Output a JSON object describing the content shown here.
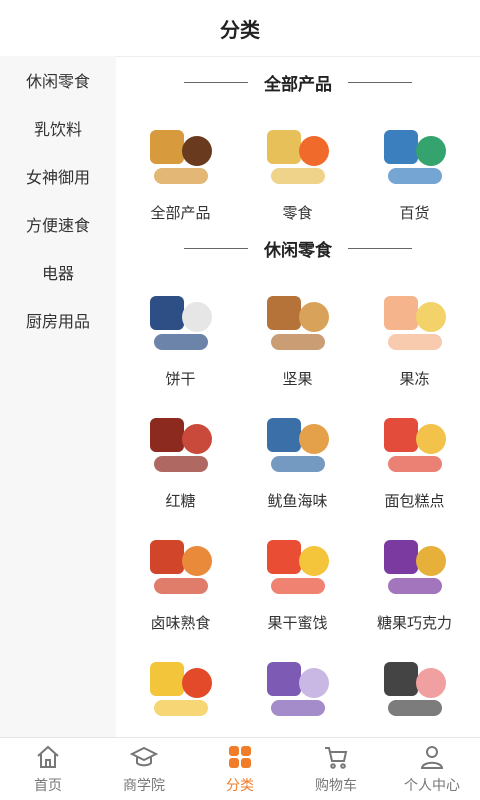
{
  "header": {
    "title": "分类"
  },
  "sidebar": {
    "items": [
      {
        "label": "休闲零食"
      },
      {
        "label": "乳饮料"
      },
      {
        "label": "女神御用"
      },
      {
        "label": "方便速食"
      },
      {
        "label": "电器"
      },
      {
        "label": "厨房用品"
      }
    ]
  },
  "sections": [
    {
      "title": "全部产品",
      "items": [
        {
          "label": "全部产品",
          "color": "#d79a3d",
          "color2": "#6a3a1e"
        },
        {
          "label": "零食",
          "color": "#e8c05a",
          "color2": "#f06b2b"
        },
        {
          "label": "百货",
          "color": "#3b7fbf",
          "color2": "#34a36d"
        }
      ]
    },
    {
      "title": "休闲零食",
      "items": [
        {
          "label": "饼干",
          "color": "#2d4f86",
          "color2": "#e6e6e6"
        },
        {
          "label": "坚果",
          "color": "#b5733a",
          "color2": "#d9a25a"
        },
        {
          "label": "果冻",
          "color": "#f5b48c",
          "color2": "#f3d26a"
        },
        {
          "label": "红糖",
          "color": "#8d2a1f",
          "color2": "#c94a3a"
        },
        {
          "label": "鱿鱼海味",
          "color": "#3a6fa8",
          "color2": "#e5a04a"
        },
        {
          "label": "面包糕点",
          "color": "#e34b3a",
          "color2": "#f2c24a"
        },
        {
          "label": "卤味熟食",
          "color": "#d1462b",
          "color2": "#e88a3a"
        },
        {
          "label": "果干蜜饯",
          "color": "#e94d34",
          "color2": "#f4c43a"
        },
        {
          "label": "糖果巧克力",
          "color": "#7a3aa0",
          "color2": "#e6b03a"
        },
        {
          "label": "",
          "color": "#f2c53a",
          "color2": "#e24a2a"
        },
        {
          "label": "",
          "color": "#7d5bb5",
          "color2": "#c9b8e3"
        },
        {
          "label": "",
          "color": "#444444",
          "color2": "#f0a0a0"
        }
      ]
    }
  ],
  "tabbar": {
    "items": [
      {
        "label": "首页",
        "icon": "home-icon"
      },
      {
        "label": "商学院",
        "icon": "graduation-cap-icon"
      },
      {
        "label": "分类",
        "icon": "category-grid-icon"
      },
      {
        "label": "购物车",
        "icon": "cart-icon"
      },
      {
        "label": "个人中心",
        "icon": "user-icon"
      }
    ]
  },
  "colors": {
    "accent": "#f07d2a",
    "sidebar_bg": "#f7f7f7",
    "text": "#333333"
  }
}
